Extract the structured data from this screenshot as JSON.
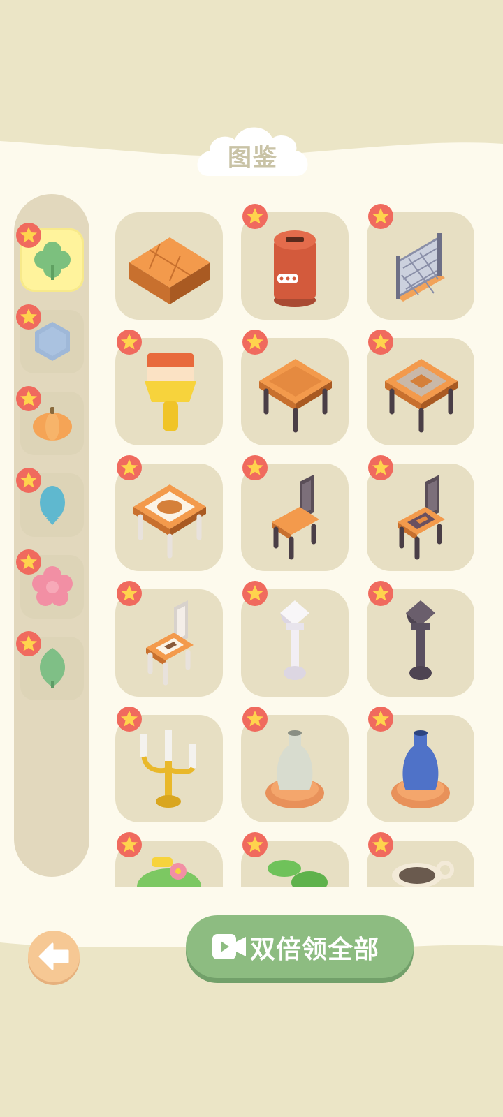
{
  "title": "图鉴",
  "double_claim_button": {
    "label": "双倍领全部"
  },
  "colors": {
    "panel_bg": "#fdfaed",
    "outer_bg": "#ebe5c6",
    "tile_bg": "#e7dfc3",
    "sidebar_bg": "#e2d8bd",
    "selected_tab": "#fff39c",
    "green_button": "#8dbc81",
    "back_button": "#f6c894",
    "star_badge": "#f06a5e",
    "star": "#ffd34d"
  },
  "categories": [
    {
      "icon": "clover-icon",
      "selected": true,
      "new": true
    },
    {
      "icon": "hexagon-icon",
      "selected": false,
      "new": true
    },
    {
      "icon": "pumpkin-icon",
      "selected": false,
      "new": true
    },
    {
      "icon": "egg-icon",
      "selected": false,
      "new": true
    },
    {
      "icon": "flower-icon",
      "selected": false,
      "new": true
    },
    {
      "icon": "leaf-icon",
      "selected": false,
      "new": true
    }
  ],
  "items": [
    {
      "icon": "brick-floor-icon",
      "new": false
    },
    {
      "icon": "mailbox-icon",
      "new": true
    },
    {
      "icon": "lattice-fence-icon",
      "new": true
    },
    {
      "icon": "paint-brush-icon",
      "new": true
    },
    {
      "icon": "wooden-table-icon",
      "new": true
    },
    {
      "icon": "tiled-table-icon",
      "new": true
    },
    {
      "icon": "ornate-white-table-icon",
      "new": true
    },
    {
      "icon": "wooden-chair-icon",
      "new": true
    },
    {
      "icon": "patterned-chair-icon",
      "new": true
    },
    {
      "icon": "white-chair-icon",
      "new": true
    },
    {
      "icon": "white-street-lamp-icon",
      "new": true
    },
    {
      "icon": "dark-street-lamp-icon",
      "new": true
    },
    {
      "icon": "candelabra-icon",
      "new": true
    },
    {
      "icon": "white-vase-icon",
      "new": true
    },
    {
      "icon": "blue-vase-icon",
      "new": true
    },
    {
      "icon": "flower-bush-icon",
      "new": true
    },
    {
      "icon": "green-plant-icon",
      "new": true
    },
    {
      "icon": "cream-pot-icon",
      "new": true
    }
  ]
}
